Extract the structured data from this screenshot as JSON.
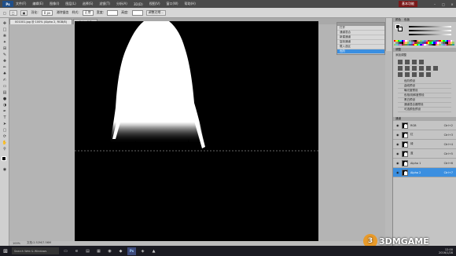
{
  "app": {
    "logo": "Ps",
    "essential_label": "基本功能"
  },
  "menu": [
    "文件(F)",
    "编辑(E)",
    "图像(I)",
    "图层(L)",
    "选择(S)",
    "滤镜(T)",
    "分析(A)",
    "3D(D)",
    "视图(V)",
    "窗口(W)",
    "帮助(H)"
  ],
  "options": {
    "feather_label": "羽化:",
    "feather_value": "0 px",
    "antialias": "消除锯齿",
    "style_label": "样式:",
    "style_value": "正常",
    "width_label": "宽度:",
    "height_label": "高度:",
    "refine_button": "调整边缘..."
  },
  "tabs": [
    "001001.jpg @ 100% (Alpha 2, RGB/8)",
    "Alpha 2/8"
  ],
  "history": {
    "items": [
      "打开",
      "通道混合",
      "新建通道",
      "复制通道",
      "载入选区",
      "色阶"
    ],
    "selected_index": 5
  },
  "right": {
    "color_tab": "颜色",
    "swatches_tab": "色板",
    "adjust_tab": "调整",
    "adjust_sub": "添加调整",
    "presets": [
      "色阶预设",
      "曲线预设",
      "曝光度预设",
      "色相/饱和度预设",
      "黑白预设",
      "通道混合器预设",
      "可选颜色预设"
    ],
    "layers_tab": "通道",
    "channels": [
      {
        "name": "RGB",
        "shortcut": "Ctrl+2"
      },
      {
        "name": "红",
        "shortcut": "Ctrl+3"
      },
      {
        "name": "绿",
        "shortcut": "Ctrl+4"
      },
      {
        "name": "蓝",
        "shortcut": "Ctrl+5"
      },
      {
        "name": "Alpha 1",
        "shortcut": "Ctrl+6"
      },
      {
        "name": "Alpha 2",
        "shortcut": "Ctrl+7"
      }
    ],
    "selected_channel": 5
  },
  "status": {
    "zoom": "100%",
    "doc": "文档:2.52M/7.56M"
  },
  "taskbar": {
    "search": "Search Web & Windows",
    "time": "12:00",
    "date": "2016/1/28"
  },
  "watermark": "3DMGAME",
  "colors": {
    "accent": "#3b8fe0",
    "essential": "#7a1a1a"
  }
}
